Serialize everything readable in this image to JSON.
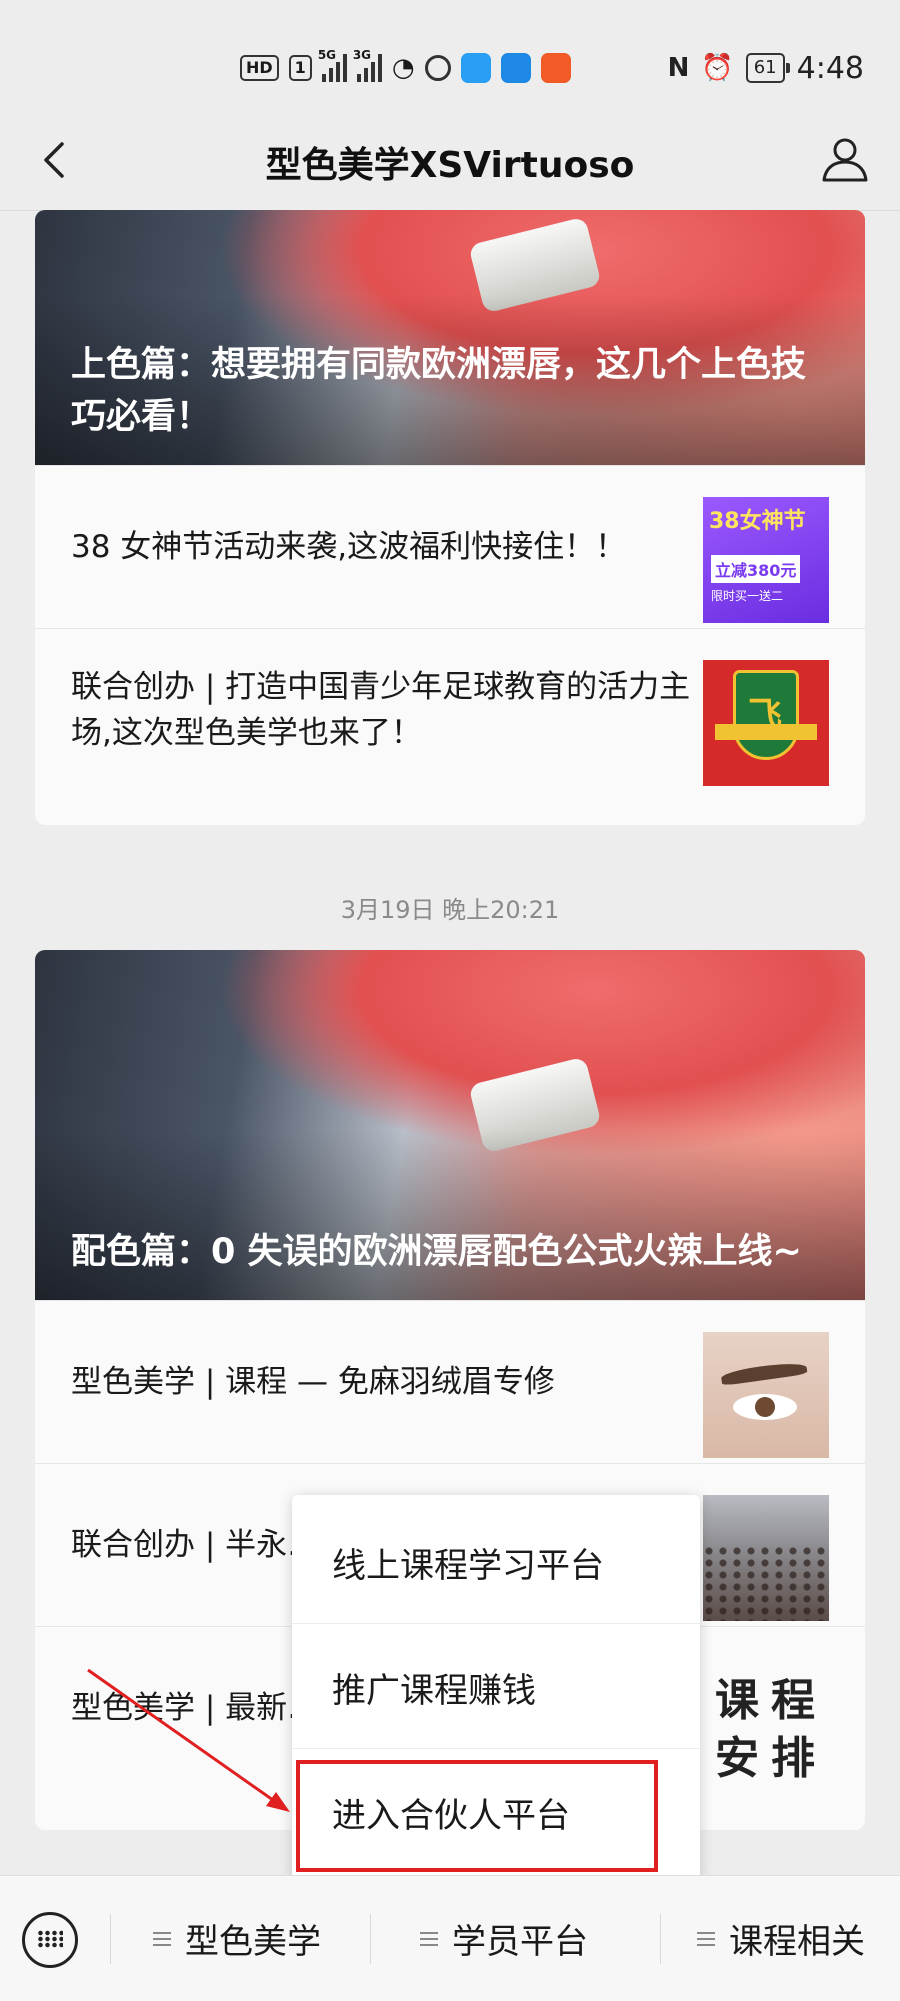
{
  "status_bar": {
    "hd_label": "HD",
    "sim_label": "1",
    "net1": "5G",
    "net2": "3G",
    "battery": "61",
    "time": "4:48"
  },
  "nav": {
    "title": "型色美学XSVirtuoso"
  },
  "article_group_1": {
    "cover_title": "上色篇：想要拥有同款欧洲漂唇，这几个上色技巧必看！",
    "items": [
      {
        "title": "38 女神节活动来袭,这波福利快接住！！",
        "thumb_lines": [
          "38女神节",
          "立减380元",
          "限时买一送二"
        ]
      },
      {
        "title": "联合创办 | 打造中国青少年足球教育的活力主场,这次型色美学也来了！",
        "thumb_lines": [
          "飞"
        ]
      }
    ]
  },
  "timestamp": "3月19日 晚上20:21",
  "article_group_2": {
    "cover_title": "配色篇：0 失误的欧洲漂唇配色公式火辣上线~",
    "items": [
      {
        "title": "型色美学 | 课程 — 免麻羽绒眉专修"
      },
      {
        "title": "联合创办 | 半永……临，充满机遇！"
      },
      {
        "title": "型色美学 | 最新……+线下课程安排",
        "thumb_lines": [
          "课",
          "程",
          "安",
          "排"
        ]
      }
    ]
  },
  "popup_menu": {
    "items": [
      "线上课程学习平台",
      "推广课程赚钱",
      "进入合伙人平台"
    ]
  },
  "bottom_menu": {
    "tabs": [
      "型色美学",
      "学员平台",
      "课程相关"
    ]
  },
  "colors": {
    "highlight": "#e02020",
    "background": "#ededed"
  }
}
